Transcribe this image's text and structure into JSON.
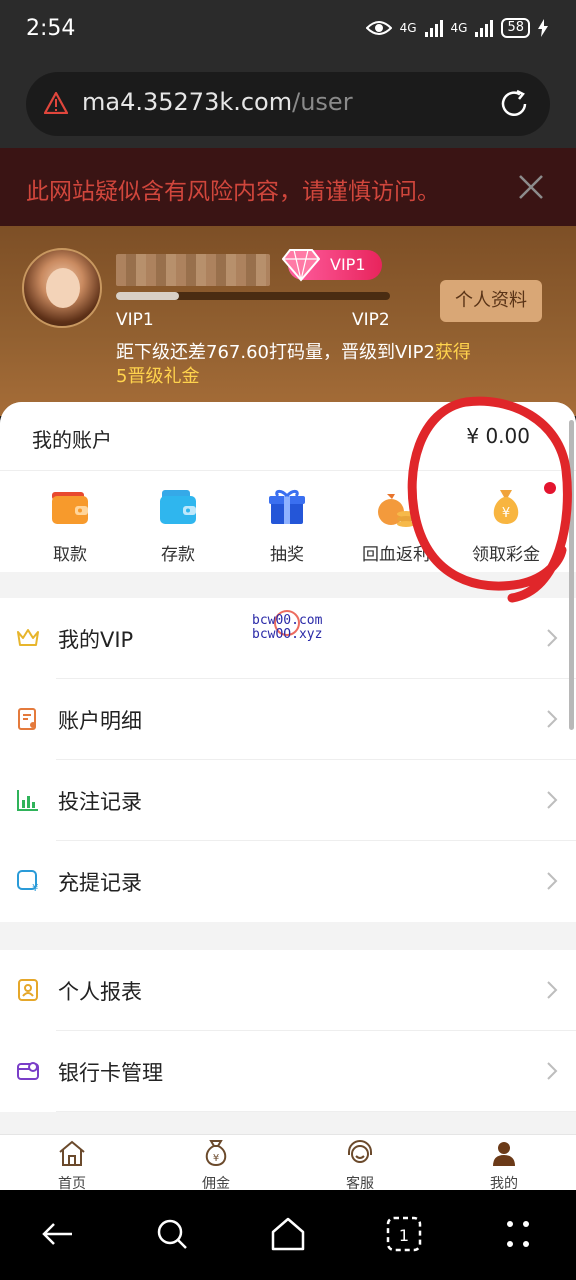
{
  "status_bar": {
    "time": "2:54",
    "network_1": "4G",
    "network_2": "4G",
    "battery": "58"
  },
  "browser": {
    "url_host": "ma4.35273k.com",
    "url_path": "/user"
  },
  "risk_warning": {
    "text": "此网站疑似含有风险内容，请谨慎访问。"
  },
  "profile": {
    "vip_badge": "VIP1",
    "current_level": "VIP1",
    "next_level": "VIP2",
    "progress": 0.23,
    "profile_button": "个人资料",
    "upgrade_text": "距下级还差767.60打码量，晋级到VIP2",
    "upgrade_reward_part1": "获得",
    "upgrade_reward_part2": "5晋级礼金"
  },
  "account": {
    "title": "我的账户",
    "balance": "¥ 0.00",
    "actions": [
      {
        "label": "取款",
        "icon": "wallet-withdraw-icon"
      },
      {
        "label": "存款",
        "icon": "wallet-deposit-icon"
      },
      {
        "label": "抽奖",
        "icon": "gift-icon"
      },
      {
        "label": "回血返利",
        "icon": "rebate-bag-icon"
      },
      {
        "label": "领取彩金",
        "icon": "money-bag-icon"
      }
    ]
  },
  "menu_group_1": [
    {
      "label": "我的VIP",
      "icon": "crown-icon"
    },
    {
      "label": "账户明细",
      "icon": "account-detail-icon"
    },
    {
      "label": "投注记录",
      "icon": "bet-chart-icon"
    },
    {
      "label": "充提记录",
      "icon": "recharge-icon"
    }
  ],
  "menu_group_2": [
    {
      "label": "个人报表",
      "icon": "report-icon"
    },
    {
      "label": "银行卡管理",
      "icon": "bank-card-icon"
    }
  ],
  "watermark": {
    "line1": "bcw00.com",
    "line2": "bcwOO.xyz"
  },
  "tabbar": [
    {
      "label": "首页",
      "icon": "home-icon"
    },
    {
      "label": "佣金",
      "icon": "commission-bag-icon"
    },
    {
      "label": "客服",
      "icon": "support-headset-icon"
    },
    {
      "label": "我的",
      "icon": "profile-icon"
    }
  ],
  "colors": {
    "accent_gold": "#d9a776",
    "highlight_yellow": "#ffd34d",
    "warning_red": "#d0463c",
    "annotation_red": "#e0262a"
  }
}
